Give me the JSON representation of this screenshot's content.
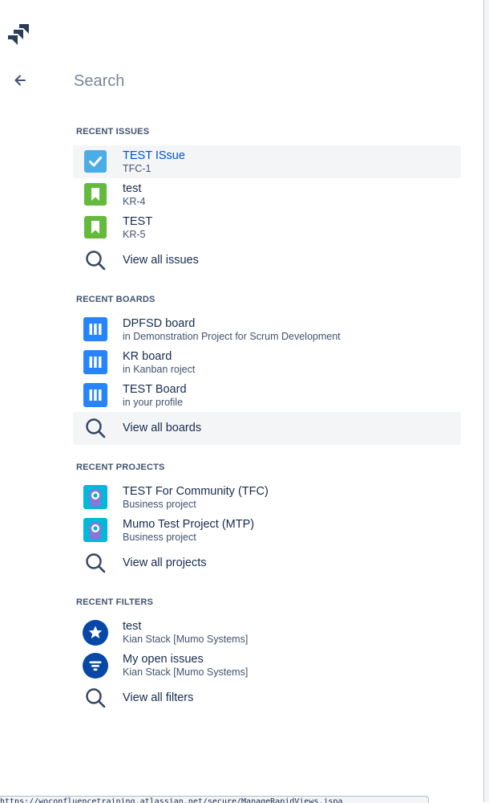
{
  "app": {
    "logo_name": "jira-logo"
  },
  "search": {
    "placeholder": "Search",
    "value": ""
  },
  "sections": {
    "issues": {
      "title": "RECENT ISSUES",
      "items": [
        {
          "title": "TEST ISsue",
          "subtitle": "TFC-1",
          "icon": "task-checkbox-icon"
        },
        {
          "title": "test",
          "subtitle": "KR-4",
          "icon": "story-bookmark-icon"
        },
        {
          "title": "TEST",
          "subtitle": "KR-5",
          "icon": "story-bookmark-icon"
        }
      ],
      "view_all": "View all issues"
    },
    "boards": {
      "title": "RECENT BOARDS",
      "items": [
        {
          "title": "DPFSD board",
          "subtitle": "in Demonstration Project for Scrum Development",
          "icon": "board-icon"
        },
        {
          "title": "KR board",
          "subtitle": "in Kanban roject",
          "icon": "board-icon"
        },
        {
          "title": "TEST Board",
          "subtitle": "in your profile",
          "icon": "board-icon"
        }
      ],
      "view_all": "View all boards"
    },
    "projects": {
      "title": "RECENT PROJECTS",
      "items": [
        {
          "title": "TEST For Community (TFC)",
          "subtitle": "Business project",
          "icon": "project-avatar-icon"
        },
        {
          "title": "Mumo Test Project (MTP)",
          "subtitle": "Business project",
          "icon": "project-avatar-icon"
        }
      ],
      "view_all": "View all projects"
    },
    "filters": {
      "title": "RECENT FILTERS",
      "items": [
        {
          "title": "test",
          "subtitle": "Kian Stack [Mumo Systems]",
          "icon": "star-filter-icon"
        },
        {
          "title": "My open issues",
          "subtitle": "Kian Stack [Mumo Systems]",
          "icon": "filter-icon"
        }
      ],
      "view_all": "View all filters"
    }
  },
  "status_url": "https://woconfluencetraining.atlassian.net/secure/ManageRapidViews.jspa",
  "colors": {
    "accent_link": "#0052cc",
    "task_blue": "#4bade8",
    "story_green": "#63ba3c",
    "board_blue": "#2684ff",
    "filter_navy": "#0747a6",
    "project_teal": "#00b8d9",
    "project_purple": "#8777d9",
    "highlight_bg": "#f4f5f7"
  }
}
